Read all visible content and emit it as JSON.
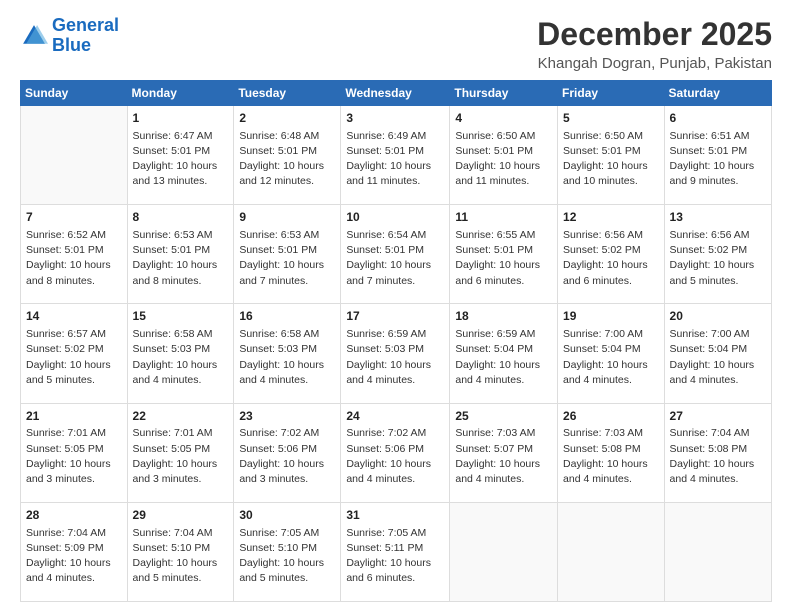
{
  "header": {
    "logo_line1": "General",
    "logo_line2": "Blue",
    "title": "December 2025",
    "subtitle": "Khangah Dogran, Punjab, Pakistan"
  },
  "days_of_week": [
    "Sunday",
    "Monday",
    "Tuesday",
    "Wednesday",
    "Thursday",
    "Friday",
    "Saturday"
  ],
  "weeks": [
    [
      {
        "day": "",
        "info": ""
      },
      {
        "day": "1",
        "info": "Sunrise: 6:47 AM\nSunset: 5:01 PM\nDaylight: 10 hours\nand 13 minutes."
      },
      {
        "day": "2",
        "info": "Sunrise: 6:48 AM\nSunset: 5:01 PM\nDaylight: 10 hours\nand 12 minutes."
      },
      {
        "day": "3",
        "info": "Sunrise: 6:49 AM\nSunset: 5:01 PM\nDaylight: 10 hours\nand 11 minutes."
      },
      {
        "day": "4",
        "info": "Sunrise: 6:50 AM\nSunset: 5:01 PM\nDaylight: 10 hours\nand 11 minutes."
      },
      {
        "day": "5",
        "info": "Sunrise: 6:50 AM\nSunset: 5:01 PM\nDaylight: 10 hours\nand 10 minutes."
      },
      {
        "day": "6",
        "info": "Sunrise: 6:51 AM\nSunset: 5:01 PM\nDaylight: 10 hours\nand 9 minutes."
      }
    ],
    [
      {
        "day": "7",
        "info": "Sunrise: 6:52 AM\nSunset: 5:01 PM\nDaylight: 10 hours\nand 8 minutes."
      },
      {
        "day": "8",
        "info": "Sunrise: 6:53 AM\nSunset: 5:01 PM\nDaylight: 10 hours\nand 8 minutes."
      },
      {
        "day": "9",
        "info": "Sunrise: 6:53 AM\nSunset: 5:01 PM\nDaylight: 10 hours\nand 7 minutes."
      },
      {
        "day": "10",
        "info": "Sunrise: 6:54 AM\nSunset: 5:01 PM\nDaylight: 10 hours\nand 7 minutes."
      },
      {
        "day": "11",
        "info": "Sunrise: 6:55 AM\nSunset: 5:01 PM\nDaylight: 10 hours\nand 6 minutes."
      },
      {
        "day": "12",
        "info": "Sunrise: 6:56 AM\nSunset: 5:02 PM\nDaylight: 10 hours\nand 6 minutes."
      },
      {
        "day": "13",
        "info": "Sunrise: 6:56 AM\nSunset: 5:02 PM\nDaylight: 10 hours\nand 5 minutes."
      }
    ],
    [
      {
        "day": "14",
        "info": "Sunrise: 6:57 AM\nSunset: 5:02 PM\nDaylight: 10 hours\nand 5 minutes."
      },
      {
        "day": "15",
        "info": "Sunrise: 6:58 AM\nSunset: 5:03 PM\nDaylight: 10 hours\nand 4 minutes."
      },
      {
        "day": "16",
        "info": "Sunrise: 6:58 AM\nSunset: 5:03 PM\nDaylight: 10 hours\nand 4 minutes."
      },
      {
        "day": "17",
        "info": "Sunrise: 6:59 AM\nSunset: 5:03 PM\nDaylight: 10 hours\nand 4 minutes."
      },
      {
        "day": "18",
        "info": "Sunrise: 6:59 AM\nSunset: 5:04 PM\nDaylight: 10 hours\nand 4 minutes."
      },
      {
        "day": "19",
        "info": "Sunrise: 7:00 AM\nSunset: 5:04 PM\nDaylight: 10 hours\nand 4 minutes."
      },
      {
        "day": "20",
        "info": "Sunrise: 7:00 AM\nSunset: 5:04 PM\nDaylight: 10 hours\nand 4 minutes."
      }
    ],
    [
      {
        "day": "21",
        "info": "Sunrise: 7:01 AM\nSunset: 5:05 PM\nDaylight: 10 hours\nand 3 minutes."
      },
      {
        "day": "22",
        "info": "Sunrise: 7:01 AM\nSunset: 5:05 PM\nDaylight: 10 hours\nand 3 minutes."
      },
      {
        "day": "23",
        "info": "Sunrise: 7:02 AM\nSunset: 5:06 PM\nDaylight: 10 hours\nand 3 minutes."
      },
      {
        "day": "24",
        "info": "Sunrise: 7:02 AM\nSunset: 5:06 PM\nDaylight: 10 hours\nand 4 minutes."
      },
      {
        "day": "25",
        "info": "Sunrise: 7:03 AM\nSunset: 5:07 PM\nDaylight: 10 hours\nand 4 minutes."
      },
      {
        "day": "26",
        "info": "Sunrise: 7:03 AM\nSunset: 5:08 PM\nDaylight: 10 hours\nand 4 minutes."
      },
      {
        "day": "27",
        "info": "Sunrise: 7:04 AM\nSunset: 5:08 PM\nDaylight: 10 hours\nand 4 minutes."
      }
    ],
    [
      {
        "day": "28",
        "info": "Sunrise: 7:04 AM\nSunset: 5:09 PM\nDaylight: 10 hours\nand 4 minutes."
      },
      {
        "day": "29",
        "info": "Sunrise: 7:04 AM\nSunset: 5:10 PM\nDaylight: 10 hours\nand 5 minutes."
      },
      {
        "day": "30",
        "info": "Sunrise: 7:05 AM\nSunset: 5:10 PM\nDaylight: 10 hours\nand 5 minutes."
      },
      {
        "day": "31",
        "info": "Sunrise: 7:05 AM\nSunset: 5:11 PM\nDaylight: 10 hours\nand 6 minutes."
      },
      {
        "day": "",
        "info": ""
      },
      {
        "day": "",
        "info": ""
      },
      {
        "day": "",
        "info": ""
      }
    ]
  ]
}
